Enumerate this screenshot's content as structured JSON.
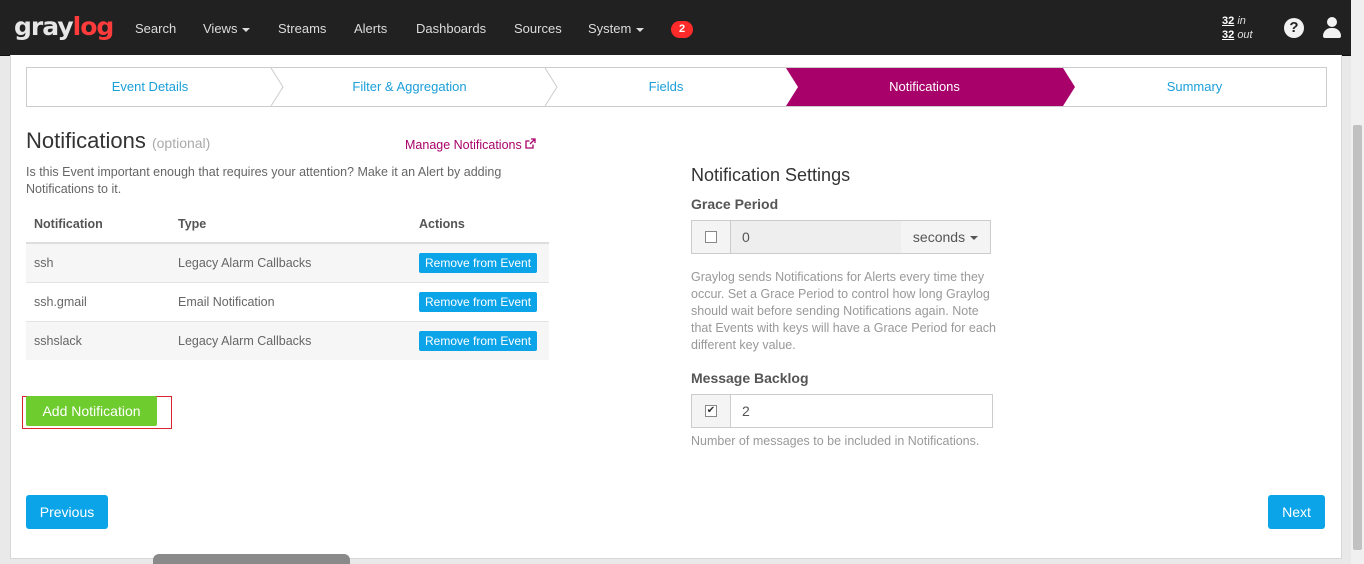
{
  "nav": {
    "logo_gray": "gray",
    "logo_red": "log",
    "items": [
      "Search",
      "Views",
      "Streams",
      "Alerts",
      "Dashboards",
      "Sources",
      "System"
    ],
    "badge": "2",
    "throughput_in_num": "32",
    "throughput_in_label": "in",
    "throughput_out_num": "32",
    "throughput_out_label": "out",
    "help_glyph": "?"
  },
  "wizard": {
    "steps": [
      "Event Details",
      "Filter & Aggregation",
      "Fields",
      "Notifications",
      "Summary"
    ],
    "active": "Notifications",
    "active_color": "#a8026a"
  },
  "notifications": {
    "title": "Notifications",
    "optional": "(optional)",
    "manage_link": "Manage Notifications",
    "description": "Is this Event important enough that requires your attention? Make it an Alert by adding Notifications to it.",
    "columns": [
      "Notification",
      "Type",
      "Actions"
    ],
    "rows": [
      {
        "name": "ssh",
        "type": "Legacy Alarm Callbacks",
        "action": "Remove from Event"
      },
      {
        "name": "ssh.gmail",
        "type": "Email Notification",
        "action": "Remove from Event"
      },
      {
        "name": "sshslack",
        "type": "Legacy Alarm Callbacks",
        "action": "Remove from Event"
      }
    ],
    "add_button": "Add Notification"
  },
  "settings": {
    "title": "Notification Settings",
    "grace_label": "Grace Period",
    "grace_checked": false,
    "grace_value": "0",
    "grace_unit": "seconds",
    "grace_help": "Graylog sends Notifications for Alerts every time they occur. Set a Grace Period to control how long Graylog should wait before sending Notifications again. Note that Events with keys will have a Grace Period for each different key value.",
    "backlog_label": "Message Backlog",
    "backlog_checked": true,
    "backlog_check_glyph": "✔",
    "backlog_value": "2",
    "backlog_help": "Number of messages to be included in Notifications."
  },
  "footer": {
    "previous": "Previous",
    "next": "Next"
  },
  "colors": {
    "brand_red": "#ff3b3b",
    "primary": "#0ba4e8",
    "success": "#6fcc2f",
    "active_step": "#a8026a"
  }
}
